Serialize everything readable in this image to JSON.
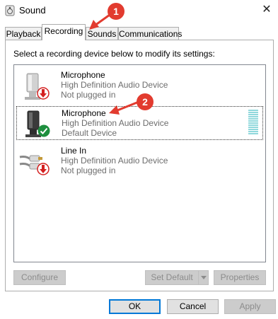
{
  "window": {
    "title": "Sound",
    "close_glyph": "✕"
  },
  "tabs": [
    {
      "label": "Playback",
      "active": false
    },
    {
      "label": "Recording",
      "active": true
    },
    {
      "label": "Sounds",
      "active": false
    },
    {
      "label": "Communications",
      "active": false
    }
  ],
  "instruction": "Select a recording device below to modify its settings:",
  "devices": [
    {
      "name": "Microphone",
      "description": "High Definition Audio Device",
      "status": "Not plugged in",
      "icon": "microphone-icon",
      "badge": "unplugged-badge-icon",
      "selected": false
    },
    {
      "name": "Microphone",
      "description": "High Definition Audio Device",
      "status": "Default Device",
      "icon": "microphone-icon",
      "badge": "default-check-badge-icon",
      "selected": true
    },
    {
      "name": "Line In",
      "description": "High Definition Audio Device",
      "status": "Not plugged in",
      "icon": "line-in-icon",
      "badge": "unplugged-badge-icon",
      "selected": false
    }
  ],
  "device_buttons": {
    "configure": "Configure",
    "set_default": "Set Default",
    "properties": "Properties"
  },
  "dialog_buttons": {
    "ok": "OK",
    "cancel": "Cancel",
    "apply": "Apply"
  },
  "annotations": [
    {
      "number": "1"
    },
    {
      "number": "2"
    }
  ],
  "colors": {
    "accent": "#0078d7",
    "annotation_red": "#e23b2f",
    "level_meter": "#90d8dc",
    "check_green": "#1e8f3e",
    "unplugged_red": "#d42020"
  }
}
